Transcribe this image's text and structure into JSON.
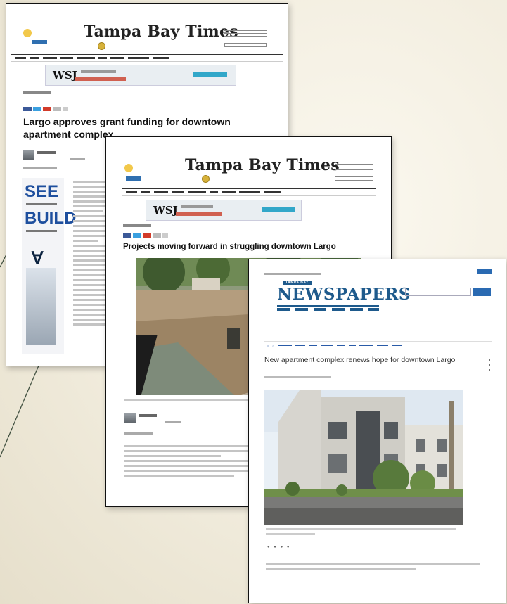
{
  "colors": {
    "accent_blue": "#1e5a8c",
    "background": "#f1ecdd"
  },
  "screenshots": [
    {
      "masthead": "Tampa Bay Times",
      "ad": {
        "brand": "WSJ"
      },
      "headline": "Largo approves grant funding for downtown apartment complex",
      "side_ad": {
        "line1": "SEE",
        "line2": "BUILD"
      }
    },
    {
      "masthead": "Tampa Bay Times",
      "ad": {
        "brand": "WSJ"
      },
      "headline": "Projects moving forward in struggling downtown Largo"
    },
    {
      "masthead_small": "TAMPA BAY",
      "masthead": "NEWSPAPERS",
      "headline": "New apartment complex renews hope for downtown Largo"
    }
  ]
}
